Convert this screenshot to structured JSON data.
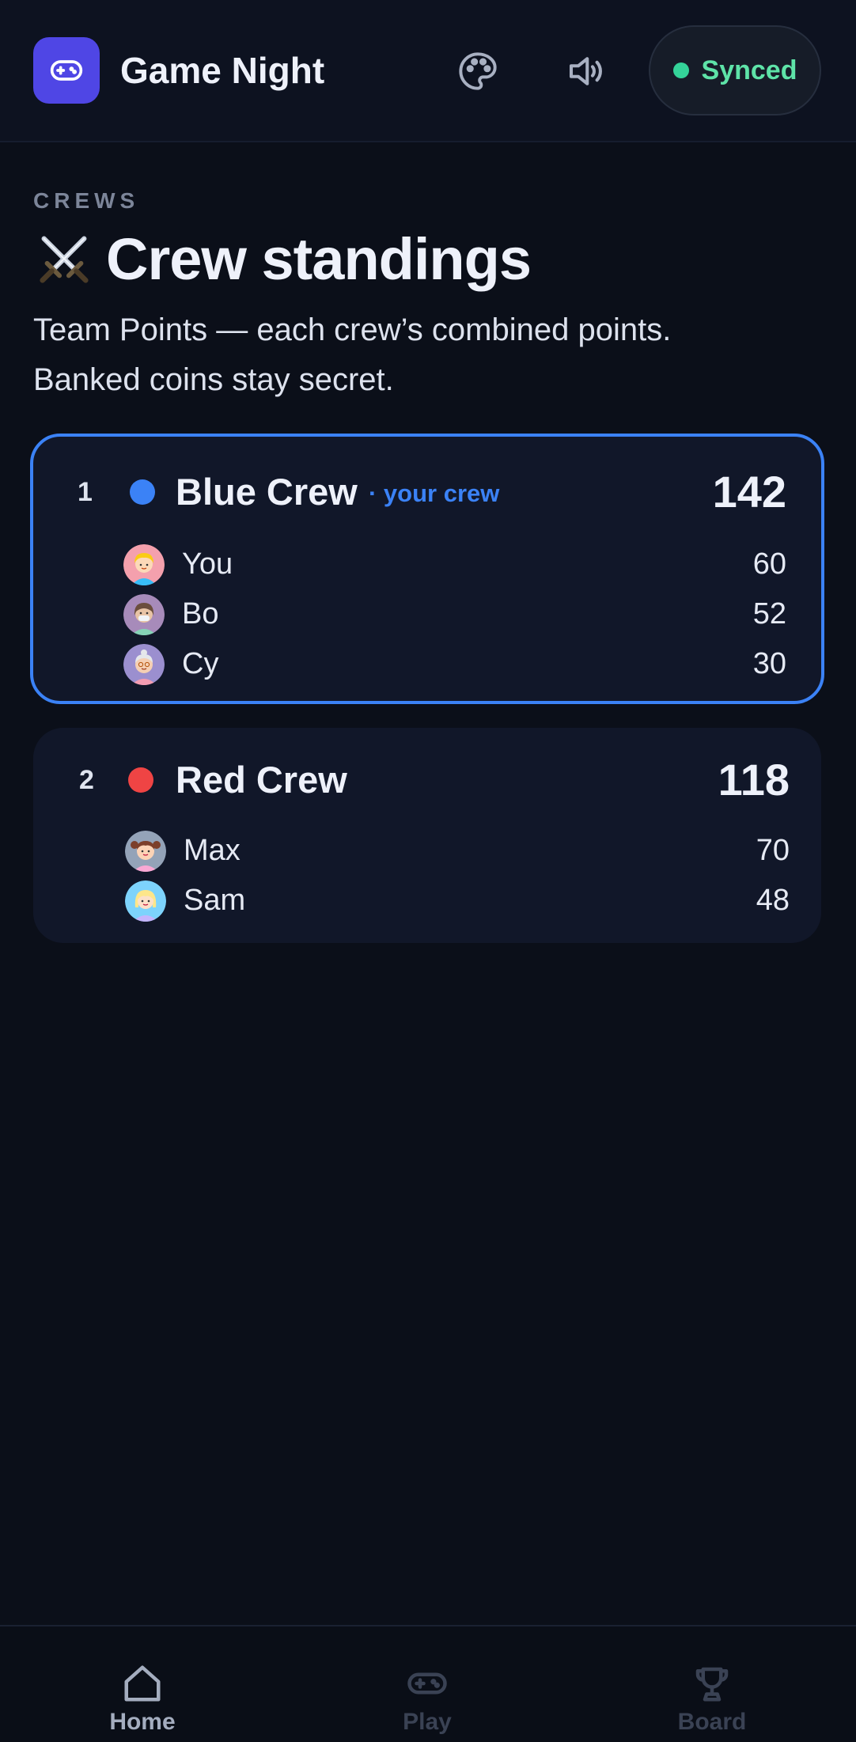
{
  "header": {
    "app_title": "Game Night",
    "logo_icon": "gamepad-icon",
    "palette_icon": "palette-icon",
    "sound_icon": "speaker-icon",
    "sync_label": "Synced",
    "sync_color": "#34d399"
  },
  "page": {
    "eyebrow": "CREWS",
    "title_emoji": "⚔️",
    "title": "Crew standings",
    "subtitle_line1": "Team Points — each crew’s combined points.",
    "subtitle_line2": "Banked coins stay secret."
  },
  "crews": [
    {
      "rank": "1",
      "name": "Blue Crew",
      "tag": "· your crew",
      "total": "142",
      "color": "#3b82f6",
      "members": [
        {
          "name": "You",
          "score": "60",
          "avatar": "blonde-girl-avatar"
        },
        {
          "name": "Bo",
          "score": "52",
          "avatar": "masked-person-avatar"
        },
        {
          "name": "Cy",
          "score": "30",
          "avatar": "grandma-avatar"
        }
      ]
    },
    {
      "rank": "2",
      "name": "Red Crew",
      "tag": "",
      "total": "118",
      "color": "#ef4444",
      "members": [
        {
          "name": "Max",
          "score": "70",
          "avatar": "pigtails-girl-avatar"
        },
        {
          "name": "Sam",
          "score": "48",
          "avatar": "blonde-woman-avatar"
        }
      ]
    }
  ],
  "nav": {
    "items": [
      {
        "label": "Home",
        "icon": "home-icon",
        "active": true
      },
      {
        "label": "Play",
        "icon": "gamepad-icon",
        "active": false
      },
      {
        "label": "Board",
        "icon": "trophy-icon",
        "active": false
      }
    ]
  }
}
